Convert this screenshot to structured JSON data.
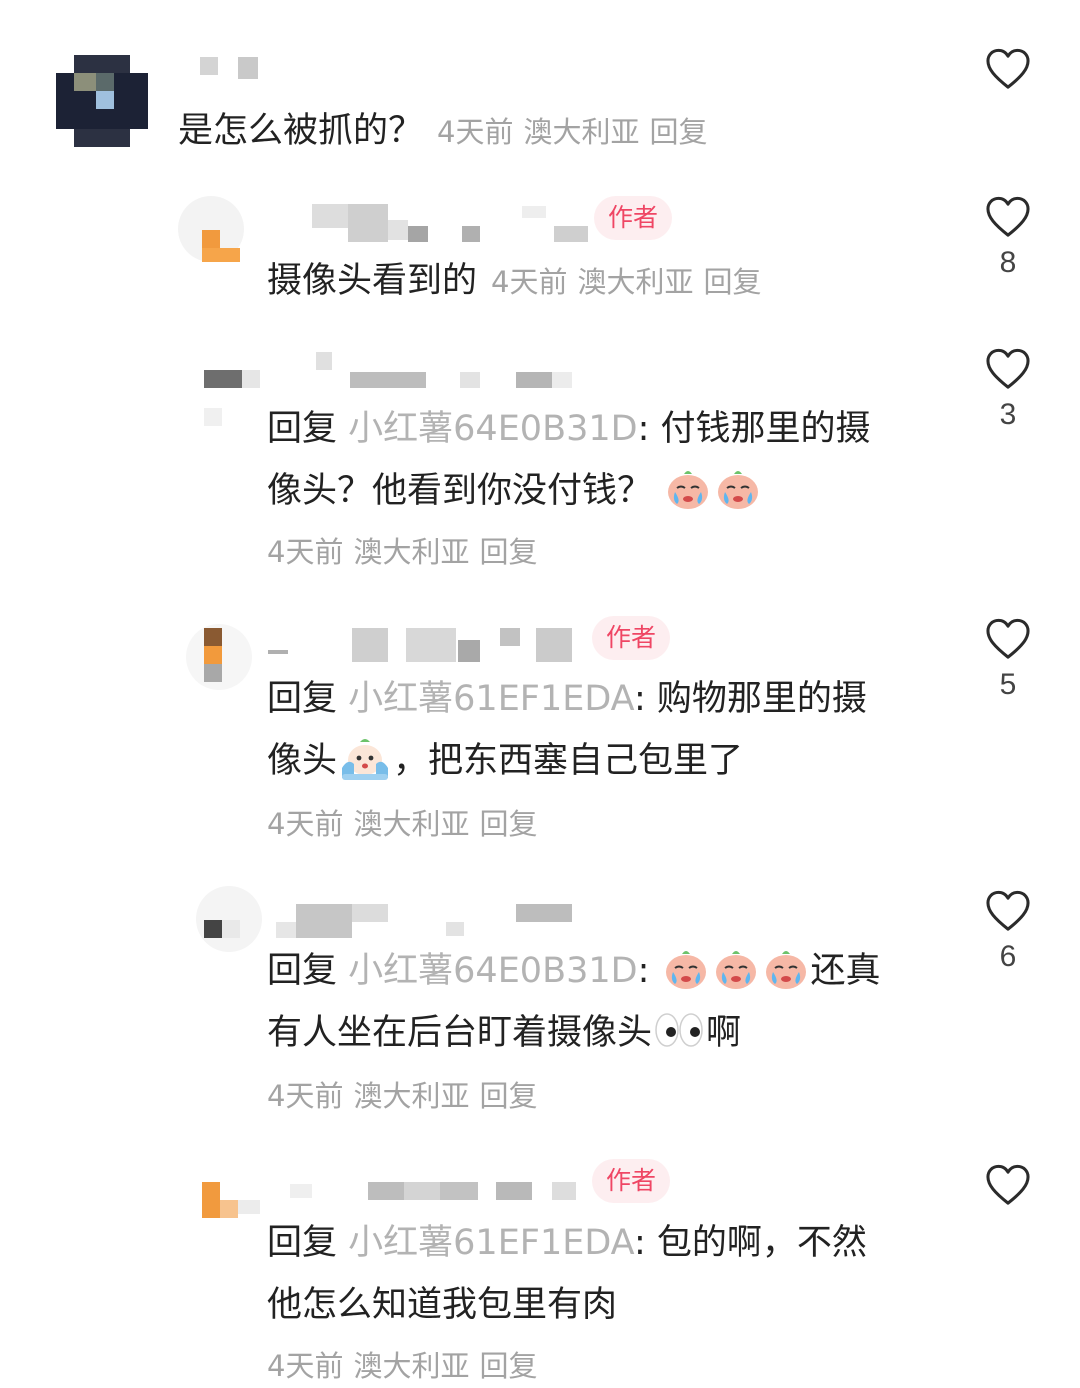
{
  "comments": [
    {
      "text": "是怎么被抓的？",
      "time": "4天前",
      "location": "澳大利亚",
      "reply_label": "回复",
      "likes": ""
    },
    {
      "author_badge": "作者",
      "text": "摄像头看到的",
      "time": "4天前",
      "location": "澳大利亚",
      "reply_label": "回复",
      "likes": "8"
    },
    {
      "reply_prefix": "回复",
      "reply_target": "小红薯64E0B31D",
      "colon": ":",
      "line1": "付钱那里的摄",
      "line2": "像头？他看到你没付钱？",
      "time": "4天前",
      "location": "澳大利亚",
      "reply_label": "回复",
      "likes": "3"
    },
    {
      "author_badge": "作者",
      "reply_prefix": "回复",
      "reply_target": "小红薯61EF1EDA",
      "colon": ":",
      "line1": "购物那里的摄",
      "line2a": "像头",
      "line2b": "，把东西塞自己包里了",
      "time": "4天前",
      "location": "澳大利亚",
      "reply_label": "回复",
      "likes": "5"
    },
    {
      "reply_prefix": "回复",
      "reply_target": "小红薯64E0B31D",
      "colon": ":",
      "line1": "还真",
      "line2a": "有人坐在后台盯着摄像头",
      "line2b": "啊",
      "time": "4天前",
      "location": "澳大利亚",
      "reply_label": "回复",
      "likes": "6"
    },
    {
      "author_badge": "作者",
      "reply_prefix": "回复",
      "reply_target": "小红薯61EF1EDA",
      "colon": ":",
      "line1": "包的啊，不然",
      "line2": "他怎么知道我包里有肉",
      "time": "4天前",
      "location": "澳大利亚",
      "reply_label": "回复",
      "likes": ""
    }
  ],
  "icons": {
    "like": "heart-outline-icon",
    "crying_emoji": "crying-peach-emoji-icon",
    "scared_emoji": "scared-face-emoji-icon",
    "eyes_emoji": "eyes-emoji-icon"
  },
  "colors": {
    "author_badge_bg": "#fdeef0",
    "author_badge_text": "#ef4664",
    "reply_target": "#b3b3b3",
    "meta": "#a3a3a3"
  }
}
